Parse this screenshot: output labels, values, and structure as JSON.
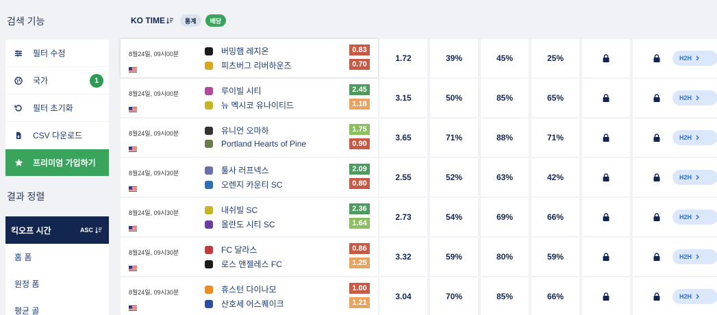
{
  "sidebar": {
    "search_title": "검색 기능",
    "menu": [
      {
        "label": "필터 수정",
        "icon": "sliders-icon"
      },
      {
        "label": "국가",
        "icon": "globe-icon",
        "badge": "1"
      },
      {
        "label": "필터 초기화",
        "icon": "reset-icon"
      },
      {
        "label": "CSV 다운로드",
        "icon": "download-icon"
      },
      {
        "label": "프리미엄 가입하기",
        "icon": "star-icon",
        "highlight": true
      }
    ],
    "sort_title": "결과 정렬",
    "sort_active": {
      "label": "킥오프 시간",
      "dir": "ASC"
    },
    "sort_items": [
      "홈 폼",
      "원정 폼",
      "평균 골"
    ]
  },
  "header": {
    "title": "KO TIME",
    "stats_label": "통계",
    "odds_label": "배당"
  },
  "colors": {
    "navy": "#13264f",
    "green": "#3aa35c",
    "odds_red": "#c75a45",
    "odds_orange": "#e8a45e",
    "odds_green": "#4f9a5f",
    "odds_lightgreen": "#8bbf62"
  },
  "rows": [
    {
      "ko": "8월24일, 09시00분",
      "home": "버밍햄 레지온",
      "away": "피츠버그 리버하운즈",
      "odd_home": "0.83",
      "odd_away": "0.70",
      "odd_home_color": "#c75a45",
      "odd_away_color": "#c75a45",
      "v1": "1.72",
      "v2": "39%",
      "v3": "45%",
      "v4": "25%"
    },
    {
      "ko": "8월24일, 09시00분",
      "home": "루이빌 시티",
      "away": "뉴 멕시코 유나이티드",
      "odd_home": "2.45",
      "odd_away": "1.18",
      "odd_home_color": "#4f9a5f",
      "odd_away_color": "#e8a45e",
      "v1": "3.15",
      "v2": "50%",
      "v3": "85%",
      "v4": "65%"
    },
    {
      "ko": "8월24일, 09시00분",
      "home": "유니언 오마하",
      "away": "Portland Hearts of Pine",
      "odd_home": "1.75",
      "odd_away": "0.90",
      "odd_home_color": "#8bbf62",
      "odd_away_color": "#c75a45",
      "v1": "3.65",
      "v2": "71%",
      "v3": "88%",
      "v4": "71%"
    },
    {
      "ko": "8월24일, 09시30분",
      "home": "툴사 러프넥스",
      "away": "오렌지 카운티 SC",
      "odd_home": "2.09",
      "odd_away": "0.80",
      "odd_home_color": "#4f9a5f",
      "odd_away_color": "#c75a45",
      "v1": "2.55",
      "v2": "52%",
      "v3": "63%",
      "v4": "42%"
    },
    {
      "ko": "8월24일, 09시30분",
      "home": "내쉬빌 SC",
      "away": "올란도 시티 SC",
      "odd_home": "2.36",
      "odd_away": "1.64",
      "odd_home_color": "#4f9a5f",
      "odd_away_color": "#8bbf62",
      "v1": "2.73",
      "v2": "54%",
      "v3": "69%",
      "v4": "66%"
    },
    {
      "ko": "8월24일, 09시30분",
      "home": "FC 달라스",
      "away": "로스 앤젤레스 FC",
      "odd_home": "0.86",
      "odd_away": "1.25",
      "odd_home_color": "#c75a45",
      "odd_away_color": "#e8a45e",
      "v1": "3.32",
      "v2": "59%",
      "v3": "80%",
      "v4": "59%"
    },
    {
      "ko": "8월24일, 09시30분",
      "home": "휴스턴 다이나모",
      "away": "산호세 어스퀘이크",
      "odd_home": "1.00",
      "odd_away": "1.21",
      "odd_home_color": "#c75a45",
      "odd_away_color": "#e8a45e",
      "v1": "3.04",
      "v2": "70%",
      "v3": "85%",
      "v4": "66%"
    }
  ],
  "h2h_label": "H2H"
}
